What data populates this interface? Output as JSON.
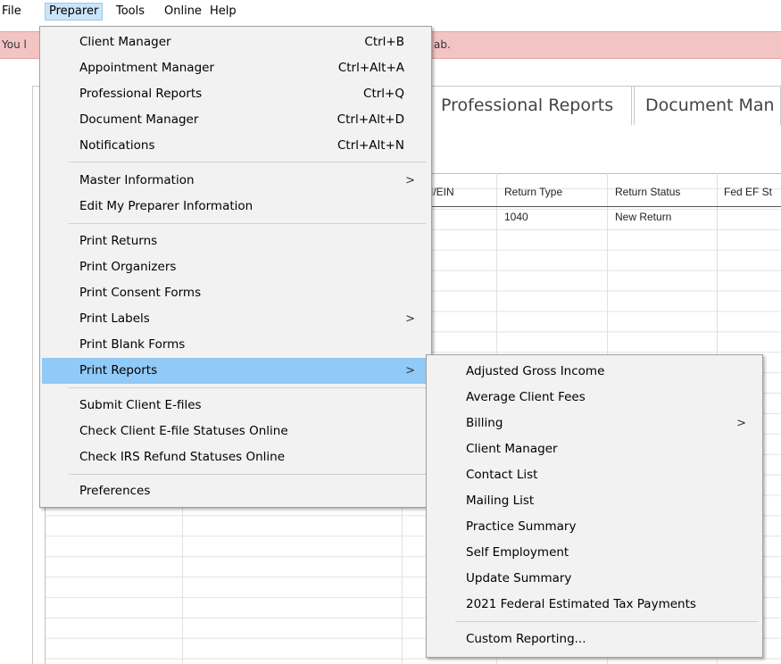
{
  "menubar": {
    "items": [
      {
        "label": "File"
      },
      {
        "label": "Preparer"
      },
      {
        "label": "Tools"
      },
      {
        "label": "Online"
      },
      {
        "label": "Help"
      }
    ]
  },
  "banner": {
    "left_text": "You l",
    "right_text": "ab."
  },
  "tabs": [
    {
      "label": "Professional Reports"
    },
    {
      "label": "Document Man"
    }
  ],
  "grid": {
    "columns": [
      "I/EIN",
      "Return Type",
      "Return Status",
      "Fed EF St"
    ],
    "rows": [
      {
        "return_type": "1040",
        "return_status": "New Return"
      }
    ]
  },
  "preparer_menu": {
    "items": [
      {
        "label": "Client Manager",
        "shortcut": "Ctrl+B"
      },
      {
        "label": "Appointment Manager",
        "shortcut": "Ctrl+Alt+A"
      },
      {
        "label": "Professional Reports",
        "shortcut": "Ctrl+Q"
      },
      {
        "label": "Document Manager",
        "shortcut": "Ctrl+Alt+D"
      },
      {
        "label": "Notifications",
        "shortcut": "Ctrl+Alt+N"
      },
      {
        "label": "Master Information",
        "shortcut": ""
      },
      {
        "label": "Edit My Preparer Information",
        "shortcut": ""
      },
      {
        "label": "Print Returns",
        "shortcut": ""
      },
      {
        "label": "Print Organizers",
        "shortcut": ""
      },
      {
        "label": "Print Consent Forms",
        "shortcut": ""
      },
      {
        "label": "Print Labels",
        "shortcut": ""
      },
      {
        "label": "Print Blank Forms",
        "shortcut": ""
      },
      {
        "label": "Print Reports",
        "shortcut": ""
      },
      {
        "label": "Submit Client E-files",
        "shortcut": ""
      },
      {
        "label": "Check Client E-file Statuses Online",
        "shortcut": ""
      },
      {
        "label": "Check IRS Refund Statuses Online",
        "shortcut": ""
      },
      {
        "label": "Preferences",
        "shortcut": ""
      }
    ],
    "submenu_arrow": ">"
  },
  "print_reports_menu": {
    "items": [
      {
        "label": "Adjusted Gross Income"
      },
      {
        "label": "Average Client Fees"
      },
      {
        "label": "Billing"
      },
      {
        "label": "Client Manager"
      },
      {
        "label": "Contact List"
      },
      {
        "label": "Mailing List"
      },
      {
        "label": "Practice Summary"
      },
      {
        "label": "Self Employment"
      },
      {
        "label": "Update Summary"
      },
      {
        "label": "2021 Federal Estimated Tax Payments"
      },
      {
        "label": "Custom Reporting..."
      }
    ]
  }
}
